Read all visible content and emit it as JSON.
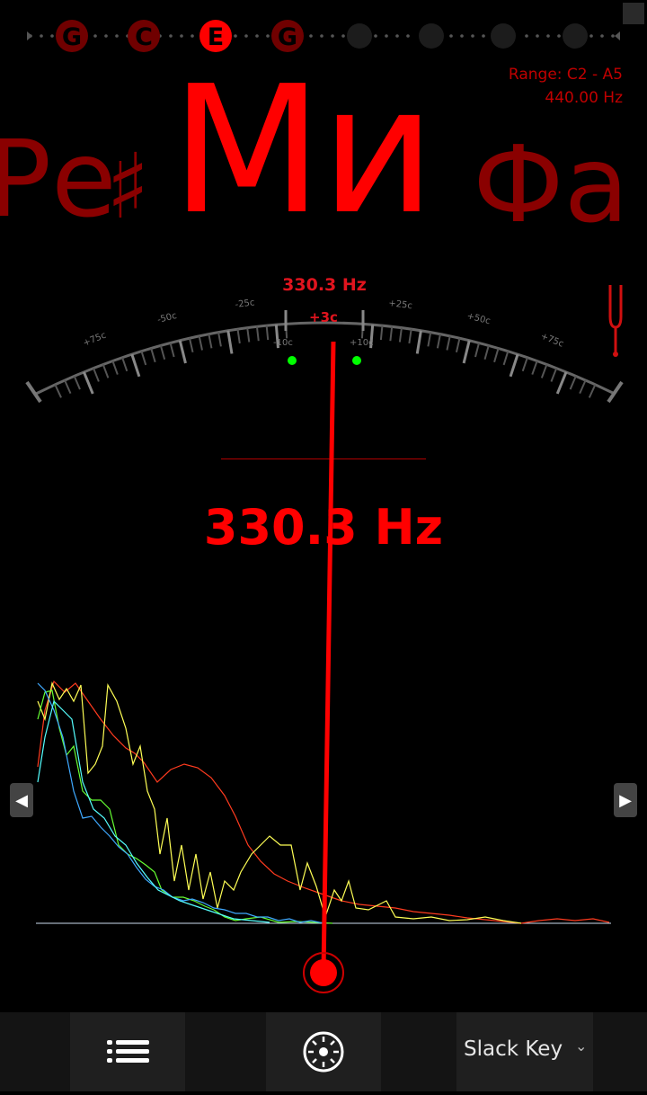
{
  "strings": [
    "G",
    "C",
    "E",
    "G"
  ],
  "active_string_index": 2,
  "empty_string_slots": 4,
  "header": {
    "range": "Range: C2 - A5",
    "reference": "440.00 Hz"
  },
  "note": {
    "previous": "Ре",
    "previous_accidental": "♯",
    "current": "Ми",
    "next": "Фа"
  },
  "meter": {
    "frequency": "330.3 Hz",
    "cents": "+3c",
    "cents_value": 3,
    "scale_labels_left": [
      "+75c",
      "-50c",
      "-25c",
      "-10c"
    ],
    "scale_labels_right": [
      "+25c",
      "+50c",
      "+75c",
      "+10c"
    ]
  },
  "frequency_display": "330.3 Hz",
  "colors": {
    "accent": "#ff0000",
    "dim_note": "#8a0000",
    "in_tune_dot": "#00ff00",
    "spectrum": [
      "#ff3b1f",
      "#ffff55",
      "#66ff33",
      "#3fa9ff",
      "#55ffff"
    ]
  },
  "icons": {
    "tuning_fork": "tuning-fork-icon",
    "menu": "list-menu-icon",
    "settings": "dial-settings-icon",
    "prev": "arrow-left-icon",
    "next": "arrow-right-icon"
  },
  "preset": {
    "label": "Slack Key",
    "chevron": "⌄"
  },
  "side_arrows": {
    "left": "◀",
    "right": "▶"
  }
}
